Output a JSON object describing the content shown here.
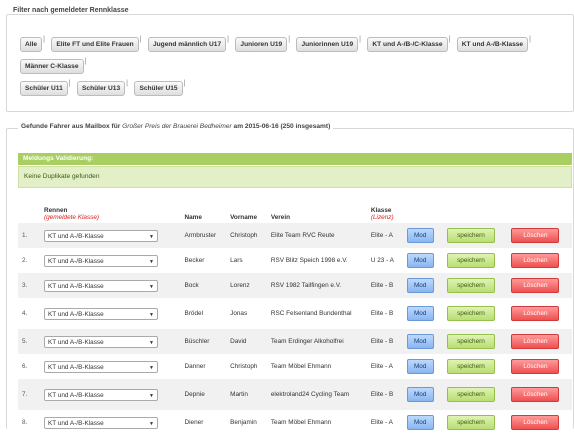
{
  "filter": {
    "legend": "Filter nach gemeldeter Rennklasse",
    "buttons": [
      "Alle",
      "Elite FT und Elite Frauen",
      "Jugend männlich U17",
      "Junioren U19",
      "Juniorinnen U19",
      "KT und A-/B-/C-Klasse",
      "KT und A-/B-Klasse",
      "Männer C-Klasse",
      "Schüler U11",
      "Schüler U13",
      "Schüler U15"
    ]
  },
  "results": {
    "legend_prefix": "Gefunde Fahrer aus Mailbox für ",
    "legend_event": "Großer Preis der Brauerei Bedheimer",
    "legend_suffix": " am 2015-06-16 (250 insgesamt)"
  },
  "validation": {
    "heading": "Meldungs Validierung:",
    "message": "Keine Duplikate gefunden"
  },
  "table": {
    "headers": {
      "rennen": "Rennen",
      "rennen_sub": "(gemeldete Klasse)",
      "name": "Name",
      "vorname": "Vorname",
      "verein": "Verein",
      "klasse": "Klasse",
      "klasse_sub": "(Lizenz)"
    },
    "rows": [
      {
        "num": "1.",
        "race": "KT und A-/B-Klasse",
        "name": "Armbruster",
        "first": "Christoph",
        "club": "Elite Team RVC Reute",
        "klasse": "Elite - A"
      },
      {
        "num": "2.",
        "race": "KT und A-/B-Klasse",
        "name": "Becker",
        "first": "Lars",
        "club": "RSV Blitz Speich 1998 e.V.",
        "klasse": "U 23 - A"
      },
      {
        "num": "3.",
        "race": "KT und A-/B-Klasse",
        "name": "Bock",
        "first": "Lorenz",
        "club": "RSV 1982 Tailfingen e.V.",
        "klasse": "Elite - B"
      },
      {
        "num": "4.",
        "race": "KT und A-/B-Klasse",
        "name": "Brödel",
        "first": "Jonas",
        "club": "RSC Felsenland Bundenthal",
        "klasse": "Elite - B"
      },
      {
        "num": "5.",
        "race": "KT und A-/B-Klasse",
        "name": "Büschler",
        "first": "David",
        "club": "Team Erdinger Alkoholfrei",
        "klasse": "Elite - B"
      },
      {
        "num": "6.",
        "race": "KT und A-/B-Klasse",
        "name": "Danner",
        "first": "Christoph",
        "club": "Team Möbel Ehmann",
        "klasse": "Elite - A"
      },
      {
        "num": "7.",
        "race": "KT und A-/B-Klasse",
        "name": "Depnie",
        "first": "Martin",
        "club": "elektroland24 Cycling Team",
        "klasse": "Elite - B"
      },
      {
        "num": "8.",
        "race": "KT und A-/B-Klasse",
        "name": "Diener",
        "first": "Benjamin",
        "club": "Team Möbel Ehmann",
        "klasse": "Elite - A"
      }
    ],
    "buttons": {
      "modify": "Mod",
      "save": "speichern",
      "delete": "Löschen"
    }
  },
  "icons": {
    "select_arrow": "chevron-down-icon"
  },
  "colors": {
    "valid_header": "#a9cf62",
    "error_red": "#d9231e",
    "save_green": "#b9de72",
    "delete_red": "#ef5050",
    "modify_blue": "#89b6f0"
  }
}
